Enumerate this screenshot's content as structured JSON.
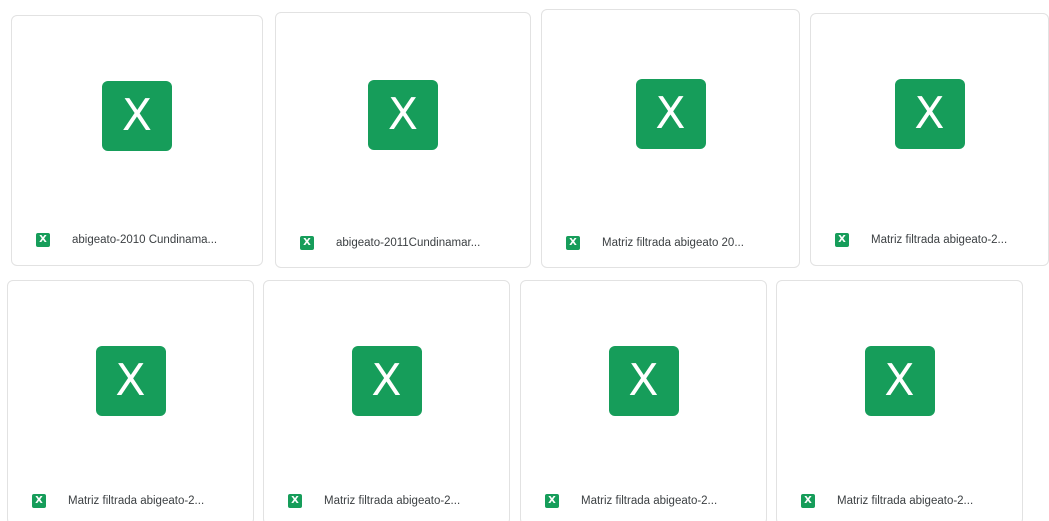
{
  "colors": {
    "excel_green": "#169D5A",
    "card_border": "#e2e2e2",
    "text": "#3c4043"
  },
  "icons": {
    "big": "excel-file-icon",
    "small": "excel-small-icon",
    "glyph": "X"
  },
  "files": [
    {
      "name": "abigeato-2010 Cundinama..."
    },
    {
      "name": "abigeato-2011Cundinamar..."
    },
    {
      "name": "Matriz filtrada abigeato 20..."
    },
    {
      "name": "Matriz filtrada abigeato-2..."
    },
    {
      "name": "Matriz filtrada abigeato-2..."
    },
    {
      "name": "Matriz filtrada abigeato-2..."
    },
    {
      "name": "Matriz filtrada abigeato-2..."
    },
    {
      "name": "Matriz filtrada abigeato-2..."
    }
  ]
}
